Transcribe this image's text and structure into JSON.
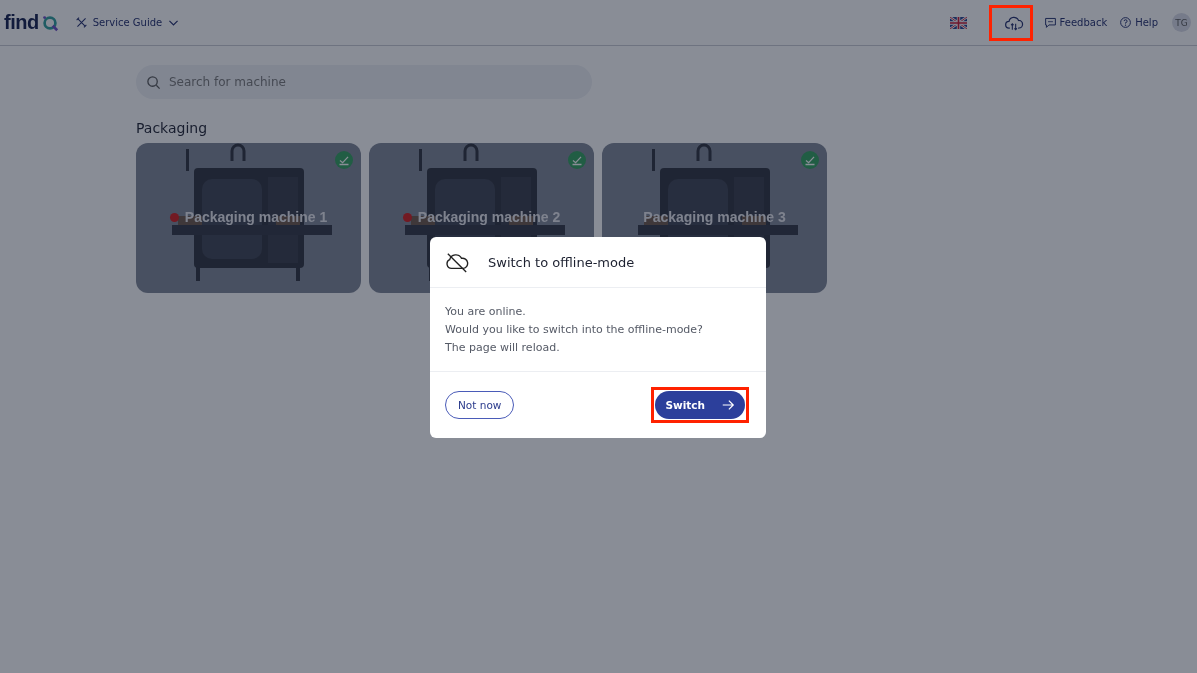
{
  "header": {
    "logo": "find",
    "product": "Service Guide",
    "actions": [
      {
        "kind": "flag"
      },
      {
        "kind": "sync",
        "highlighted": true
      },
      {
        "kind": "feedback",
        "label": "Feedback"
      },
      {
        "kind": "help",
        "label": "Help"
      }
    ],
    "avatar": "TG"
  },
  "search": {
    "placeholder": "Search for machine"
  },
  "section": {
    "title": "Packaging",
    "machines": [
      {
        "name": "Packaging machine 1",
        "alert": true,
        "synced": true
      },
      {
        "name": "Packaging machine 2",
        "alert": true,
        "synced": true
      },
      {
        "name": "Packaging machine 3",
        "alert": false,
        "synced": true
      }
    ]
  },
  "dialog": {
    "title": "Switch to offline-mode",
    "lines": [
      "You are online.",
      "Would you like to switch into the offline-mode?",
      "The page will reload."
    ],
    "buttons": [
      {
        "kind": "secondary",
        "label": "Not now"
      },
      {
        "kind": "primary",
        "label": "Switch",
        "highlighted": true
      }
    ]
  }
}
